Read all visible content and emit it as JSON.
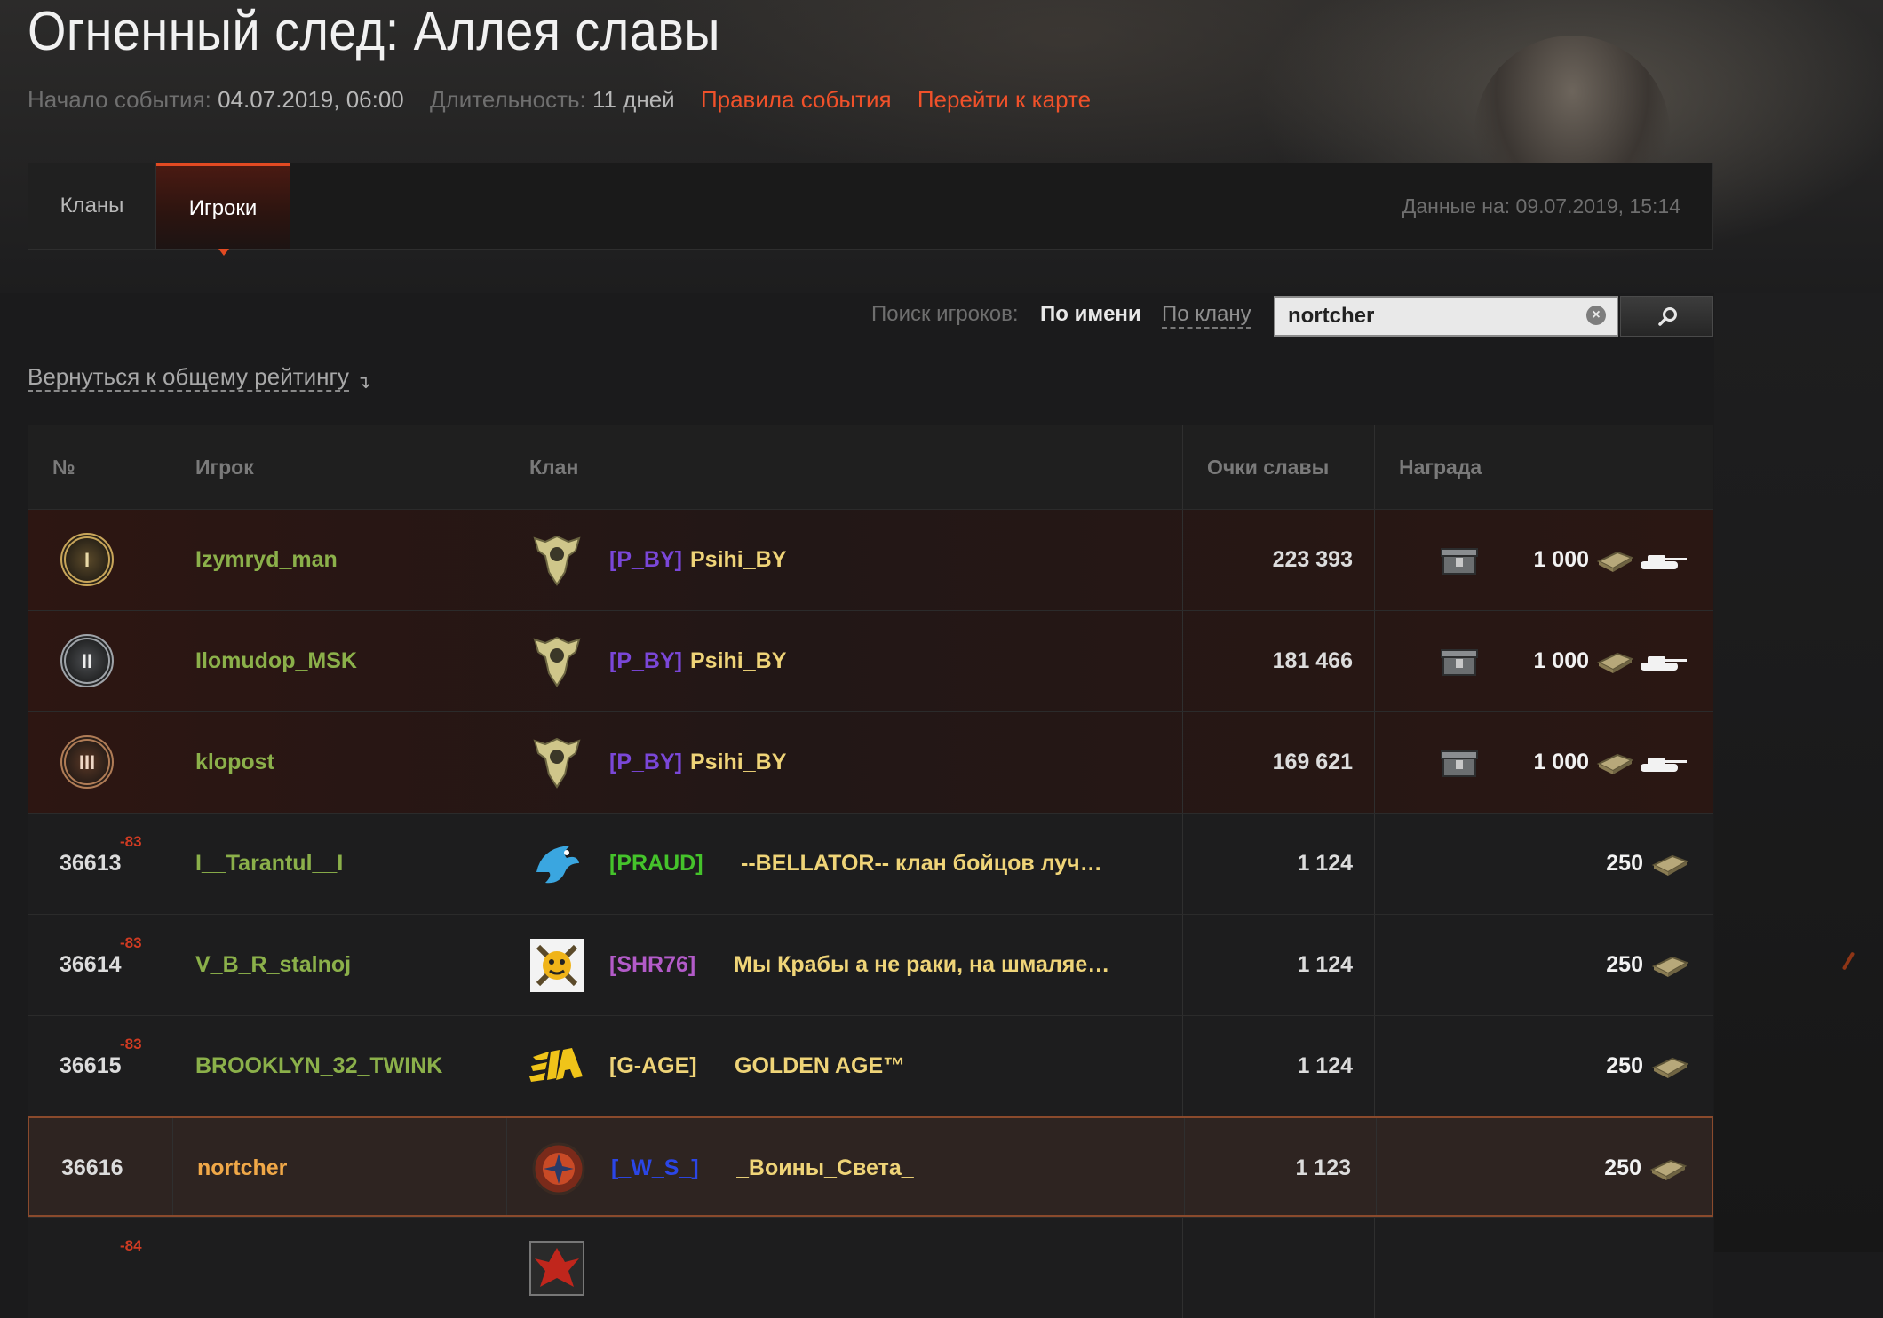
{
  "page": {
    "title": "Огненный след: Аллея славы",
    "meta": {
      "start_label": "Начало события:",
      "start_value": "04.07.2019, 06:00",
      "duration_label": "Длительность:",
      "duration_value": "11 дней",
      "rules_link": "Правила события",
      "map_link": "Перейти к карте"
    },
    "accent_color": "#f0512a"
  },
  "tabs": {
    "clans": "Кланы",
    "players": "Игроки",
    "active": "players",
    "data_date": "Данные на: 09.07.2019, 15:14"
  },
  "search": {
    "label": "Поиск игроков:",
    "by_name": "По имени",
    "by_clan": "По клану",
    "value": "nortcher",
    "clear_icon": "×",
    "button_icon": "search-icon"
  },
  "back_link": "Вернуться к общему рейтингу",
  "back_arrow": "↴",
  "table": {
    "headers": {
      "rank": "№",
      "player": "Игрок",
      "clan": "Клан",
      "score": "Очки славы",
      "reward": "Награда"
    },
    "rows": [
      {
        "medal": "I",
        "player": "Izymryd_man",
        "tag": "[P_BY]",
        "clan": "Psihi_BY",
        "score": "223 393",
        "gold": "1 000"
      },
      {
        "medal": "II",
        "player": "Ilomudop_MSK",
        "tag": "[P_BY]",
        "clan": "Psihi_BY",
        "score": "181 466",
        "gold": "1 000"
      },
      {
        "medal": "III",
        "player": "klopost",
        "tag": "[P_BY]",
        "clan": "Psihi_BY",
        "score": "169 621",
        "gold": "1 000"
      },
      {
        "rank": "36613",
        "delta": "-83",
        "player": "I__Tarantul__I",
        "tag": "[PRAUD]",
        "clan": "--BELLATOR-- клан бойцов луч…",
        "score": "1 124",
        "gold": "250"
      },
      {
        "rank": "36614",
        "delta": "-83",
        "player": "V_B_R_stalnoj",
        "tag": "[SHR76]",
        "clan": "Мы Крабы а не раки, на шмаляе…",
        "score": "1 124",
        "gold": "250"
      },
      {
        "rank": "36615",
        "delta": "-83",
        "player": "BROOKLYN_32_TWINK",
        "tag": "[G-AGE]",
        "clan": "GOLDEN AGE™",
        "score": "1 124",
        "gold": "250"
      },
      {
        "rank": "36616",
        "player": "nortcher",
        "tag": "[_W_S_]",
        "clan": "_Воины_Света_",
        "score": "1 123",
        "gold": "250"
      },
      {
        "delta": "-84"
      }
    ]
  },
  "colors": {
    "tag_pby": "#7a47d8",
    "tag_praud": "#45c32b",
    "tag_shr76": "#b35bc9",
    "tag_gage": "#efd478",
    "tag_ws": "#2b46e6",
    "player_green": "#8bb04a",
    "player_self": "#f0a848"
  }
}
